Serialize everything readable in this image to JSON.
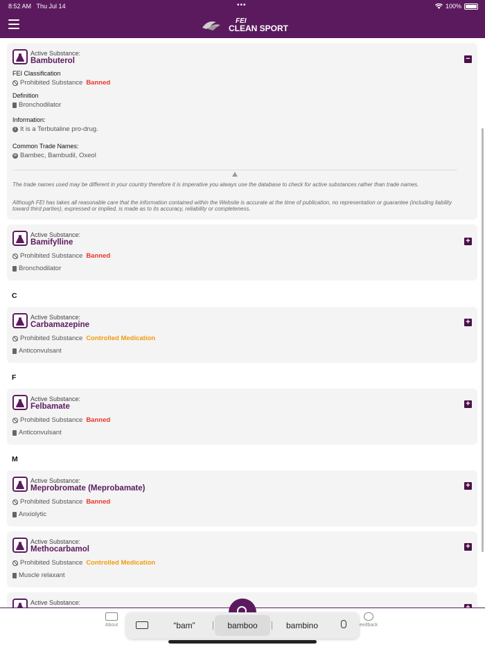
{
  "status": {
    "time": "8:52 AM",
    "date": "Thu Jul 14",
    "battery": "100%"
  },
  "header": {
    "logo_fei": "FEI",
    "logo_title": "CLEAN SPORT"
  },
  "expanded": {
    "label": "Active Substance:",
    "name": "Bambuterol",
    "classification_title": "FEI Classification",
    "status_prefix": "Prohibited Substance",
    "status": "Banned",
    "definition_title": "Definition",
    "definition": "Bronchodilator",
    "information_title": "Information:",
    "information": "It is a Terbutaline pro-drug.",
    "trade_title": "Common Trade Names:",
    "trade_names": "Bambec, Bambudil, Oxeol",
    "disclaimer1": "The trade names used may be different in your country therefore it is imperative you always use the database to check for active substances rather than trade names.",
    "disclaimer2": "Although FEI has takes all reasonable care that the information contained within the Website is accurate at the time of publication, no representation or guarantee (including liability toward third parties), expressed or implied, is made as to its accuracy, reliability or completeness."
  },
  "substances": [
    {
      "label": "Active Substance:",
      "name": "Bamifylline",
      "prefix": "Prohibited Substance",
      "status": "Banned",
      "definition": "Bronchodilator"
    },
    {
      "label": "Active Substance:",
      "name": "Carbamazepine",
      "prefix": "Prohibited Substance",
      "status": "Controlled Medication",
      "definition": "Anticonvulsant"
    },
    {
      "label": "Active Substance:",
      "name": "Felbamate",
      "prefix": "Prohibited Substance",
      "status": "Banned",
      "definition": "Anticonvulsant"
    },
    {
      "label": "Active Substance:",
      "name": "Meprobromate (Meprobamate)",
      "prefix": "Prohibited Substance",
      "status": "Banned",
      "definition": "Anxiolytic"
    },
    {
      "label": "Active Substance:",
      "name": "Methocarbamol",
      "prefix": "Prohibited Substance",
      "status": "Controlled Medication",
      "definition": "Muscle relaxant"
    },
    {
      "label": "Active Substance:"
    }
  ],
  "sections": [
    "C",
    "F",
    "M"
  ],
  "tabs": {
    "about": "About",
    "feedback": "eedback"
  },
  "keyboard_suggestions": [
    "“bam”",
    "bamboo",
    "bambino"
  ],
  "colors": {
    "brand": "#5b1a5e",
    "banned": "#e8352b",
    "controlled": "#f29a0b"
  }
}
